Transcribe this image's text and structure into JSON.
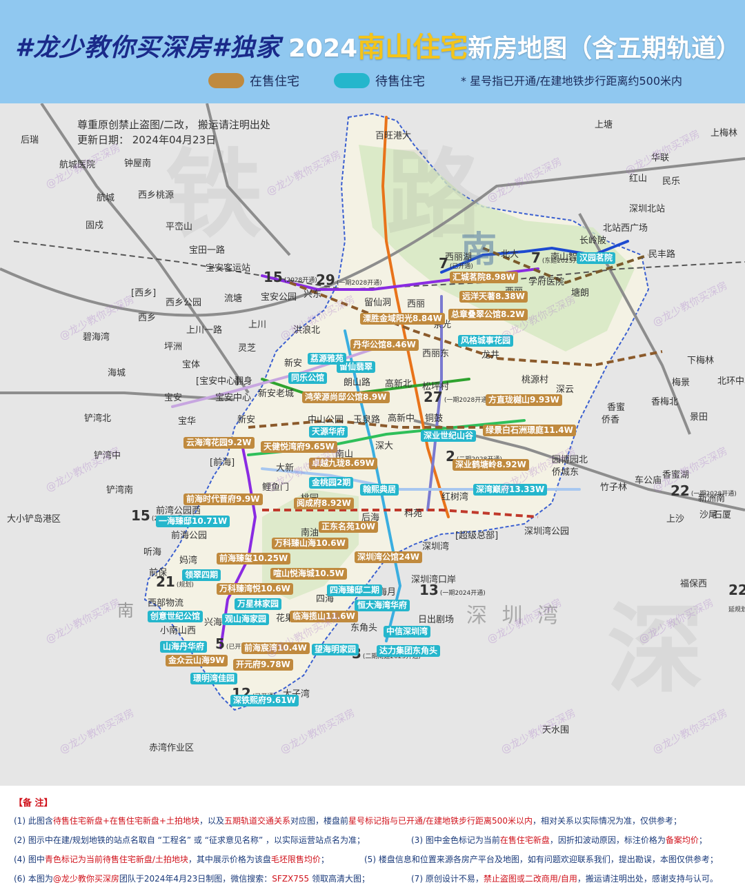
{
  "header": {
    "title_left": "#龙少教你买深房#独家",
    "title_year": "2024",
    "title_highlight": "南山住宅",
    "title_rest": "新房地图（含五期轨道）",
    "legend": {
      "on_sale": "在售住宅",
      "pending": "待售住宅",
      "star_note": "* 星号指已开通/在建地铁步行距离约500米内"
    }
  },
  "colors": {
    "on_sale": "#c08a3e",
    "pending": "#25b6cc",
    "header_bg": "#90c8f0",
    "highlight": "#f3c41b",
    "line_5": "#8a2be2",
    "line_7": "#1d4ad0",
    "line_13": "#7a7ad0",
    "line_15": "#2fa32f",
    "line_29": "#e8731a",
    "line_12": "#3aaee0",
    "line_2": "#a7c7f0"
  },
  "map": {
    "notice_1": "尊重原创禁止盗图/二改， 搬运请注明出处",
    "notice_2": "更新日期： 2024年04月23日",
    "district_watermark": "南",
    "bg_watermark_1": "铁",
    "bg_watermark_2": "路",
    "bg_watermark_3": "深",
    "watermark_text": "@龙少教你买深房",
    "places": [
      {
        "id": "houruai",
        "text": "后瑞"
      },
      {
        "id": "hangcheng-hospital",
        "text": "航城医院"
      },
      {
        "id": "zhongwuji",
        "text": "钟屋南"
      },
      {
        "id": "xixiang-taoyuan",
        "text": "西乡桃源"
      },
      {
        "id": "hangcheng",
        "text": "航城"
      },
      {
        "id": "gucheng",
        "text": "固戍"
      },
      {
        "id": "pingmanan",
        "text": "平峦山"
      },
      {
        "id": "baotian1",
        "text": "宝田一路"
      },
      {
        "id": "baoan-station",
        "text": "宝安客运站"
      },
      {
        "id": "liutang",
        "text": "流塘"
      },
      {
        "id": "baoan-park",
        "text": "宝安公园"
      },
      {
        "id": "xingdong",
        "text": "兴东"
      },
      {
        "id": "xixiang",
        "text": "[西乡]"
      },
      {
        "id": "xixiang-park",
        "text": "西乡公园"
      },
      {
        "id": "xixiang2",
        "text": "西乡"
      },
      {
        "id": "shangchuan1",
        "text": "上川一路"
      },
      {
        "id": "shangchuan",
        "text": "上川"
      },
      {
        "id": "honglangbei",
        "text": "洪浪北"
      },
      {
        "id": "bihaiwan",
        "text": "碧海湾"
      },
      {
        "id": "pingzhou",
        "text": "坪洲"
      },
      {
        "id": "lingzhi",
        "text": "灵芝"
      },
      {
        "id": "haicheng",
        "text": "海城"
      },
      {
        "id": "baoti",
        "text": "宝体"
      },
      {
        "id": "baoan-center",
        "text": "[宝安中心]"
      },
      {
        "id": "fanshen",
        "text": "翻身"
      },
      {
        "id": "baoan",
        "text": "宝安"
      },
      {
        "id": "baoan-center2",
        "text": "宝安中心"
      },
      {
        "id": "xinan-old",
        "text": "新安老城"
      },
      {
        "id": "xinan",
        "text": "新安"
      },
      {
        "id": "xinan2",
        "text": "新安"
      },
      {
        "id": "liyuwan-north",
        "text": "铲湾北"
      },
      {
        "id": "baohua",
        "text": "宝华"
      },
      {
        "id": "liyuwan-mid",
        "text": "铲湾中"
      },
      {
        "id": "liyuwan-south",
        "text": "铲湾南"
      },
      {
        "id": "qianhai",
        "text": "[前海]"
      },
      {
        "id": "daxiaochan",
        "text": "大小铲岛港区"
      },
      {
        "id": "qianwan-park-west",
        "text": "前湾公园西"
      },
      {
        "id": "qianwan-park",
        "text": "前海公园"
      },
      {
        "id": "tinghai",
        "text": "听海"
      },
      {
        "id": "mawan",
        "text": "妈湾"
      },
      {
        "id": "qianbao",
        "text": "前保"
      },
      {
        "id": "xibu-wuliu",
        "text": "西部物流"
      },
      {
        "id": "xiaonanshan-west",
        "text": "小南山西"
      },
      {
        "id": "xinghai",
        "text": "兴海"
      },
      {
        "id": "baishizhou-big",
        "text": "百旺港大"
      },
      {
        "id": "xili-lake",
        "text": "西丽湖"
      },
      {
        "id": "beida",
        "text": "北大"
      },
      {
        "id": "nanshan-zhiyuan",
        "text": "南山智园"
      },
      {
        "id": "changlingpi",
        "text": "长岭陂"
      },
      {
        "id": "xueyuan-hospital",
        "text": "学府医院"
      },
      {
        "id": "tanglang",
        "text": "塘朗"
      },
      {
        "id": "liuxiandong",
        "text": "留仙洞"
      },
      {
        "id": "xixi",
        "text": "西丽"
      },
      {
        "id": "xili-river",
        "text": "西丽"
      },
      {
        "id": "chaguang",
        "text": "茶光"
      },
      {
        "id": "longjing",
        "text": "龙井"
      },
      {
        "id": "taoyuan-village",
        "text": "桃源村"
      },
      {
        "id": "xinli-east",
        "text": "西丽东"
      },
      {
        "id": "shenyun",
        "text": "深云"
      },
      {
        "id": "gaoxin-north",
        "text": "高新北"
      },
      {
        "id": "songping",
        "text": "松坪村"
      },
      {
        "id": "mingtan",
        "text": "朗山路"
      },
      {
        "id": "gaoxin-mid",
        "text": "高新中"
      },
      {
        "id": "tongding",
        "text": "铜鼓"
      },
      {
        "id": "zhongshan-park",
        "text": "中山公园"
      },
      {
        "id": "yuquan",
        "text": "玉泉路"
      },
      {
        "id": "nanshan",
        "text": "南山"
      },
      {
        "id": "shenda",
        "text": "深大"
      },
      {
        "id": "dongxin",
        "text": "大新"
      },
      {
        "id": "liyumen",
        "text": "鲤鱼门"
      },
      {
        "id": "taoyuan",
        "text": "桃园"
      },
      {
        "id": "nanyou",
        "text": "南油"
      },
      {
        "id": "houhai",
        "text": "后海"
      },
      {
        "id": "kejinan",
        "text": "科苑"
      },
      {
        "id": "honglihu",
        "text": "红树湾"
      },
      {
        "id": "shenzhenwan-park",
        "text": "深圳湾公园"
      },
      {
        "id": "super-hq",
        "text": "[超级总部]"
      },
      {
        "id": "shenzhenwan",
        "text": "深圳湾"
      },
      {
        "id": "sz-bay-port",
        "text": "深圳湾口岸"
      },
      {
        "id": "dongjiao",
        "text": "东角头"
      },
      {
        "id": "sihai",
        "text": "四海"
      },
      {
        "id": "haiyue",
        "text": "海月"
      },
      {
        "id": "huaguo",
        "text": "花果"
      },
      {
        "id": "risheng",
        "text": "日出剧场"
      },
      {
        "id": "nanshan-dist",
        "text": "南"
      },
      {
        "id": "chiwan",
        "text": "赤湾作业区"
      },
      {
        "id": "taizi",
        "text": "大子湾"
      },
      {
        "id": "yuanhu",
        "text": "园博园北"
      },
      {
        "id": "qiaocheng-east",
        "text": "侨城东"
      },
      {
        "id": "xiangmihu",
        "text": "香蜜湖"
      },
      {
        "id": "chegongmiao",
        "text": "车公庙"
      },
      {
        "id": "zhuzilin",
        "text": "竹子林"
      },
      {
        "id": "shangsha",
        "text": "上沙"
      },
      {
        "id": "futian-bonded",
        "text": "福保西"
      },
      {
        "id": "tianshui",
        "text": "天水围"
      },
      {
        "id": "shenzhen-bay",
        "text": "深 圳 湾"
      },
      {
        "id": "shangtang",
        "text": "上塘"
      },
      {
        "id": "hualian",
        "text": "华联"
      },
      {
        "id": "hongshan",
        "text": "红山"
      },
      {
        "id": "minle",
        "text": "民乐"
      },
      {
        "id": "shenzhen-north",
        "text": "深圳北站"
      },
      {
        "id": "shenzhen-north-west",
        "text": "北站西广场"
      },
      {
        "id": "xinmin",
        "text": "民丰路"
      },
      {
        "id": "xiameilin",
        "text": "下梅林"
      },
      {
        "id": "meijing",
        "text": "梅景"
      },
      {
        "id": "xiangmei-north",
        "text": "香梅北"
      },
      {
        "id": "jingtian",
        "text": "景田"
      },
      {
        "id": "xiangmi",
        "text": "香蜜"
      },
      {
        "id": "qiaoxiang",
        "text": "侨香"
      },
      {
        "id": "bei-huan",
        "text": "北环中心"
      },
      {
        "id": "xinzhou-south",
        "text": "新洲南"
      },
      {
        "id": "shawei",
        "text": "沙尾"
      },
      {
        "id": "shi-ha",
        "text": "石厦"
      },
      {
        "id": "shenghuo",
        "text": "上梅林"
      }
    ],
    "line_numbers": [
      {
        "id": "l15-top",
        "text": "15",
        "note": "(2028开通)"
      },
      {
        "id": "l29",
        "text": "29",
        "note": "(一期2028开通)"
      },
      {
        "id": "l7-left",
        "text": "7",
        "note": "(已开通)"
      },
      {
        "id": "l7-right",
        "text": "7",
        "note": "(东延2025开通)"
      },
      {
        "id": "l27",
        "text": "27",
        "note": "(一期2028开通)"
      },
      {
        "id": "l2",
        "text": "2",
        "note": "(二期2028开通)"
      },
      {
        "id": "l15-bottom",
        "text": "15",
        "note": "(2028开通)"
      },
      {
        "id": "l21",
        "text": "21",
        "note": "(规划)"
      },
      {
        "id": "l13",
        "text": "13",
        "note": "(一期2024开通)"
      },
      {
        "id": "l5",
        "text": "5",
        "note": "(已开通)"
      },
      {
        "id": "l12",
        "text": "12",
        "note": "(已开通)"
      },
      {
        "id": "l3",
        "text": "3",
        "note": "(二期南延2025开通)"
      },
      {
        "id": "l22",
        "text": "22",
        "note": "(一期2028开通)"
      },
      {
        "id": "l22b",
        "text": "22",
        "note": "(南延规划)"
      }
    ],
    "estates": [
      {
        "id": "e1",
        "text": "汇城茗院8.98W",
        "status": "on_sale"
      },
      {
        "id": "e2",
        "text": "远洋天著8.38W",
        "status": "on_sale"
      },
      {
        "id": "e3",
        "text": "总章叠翠公馆8.2W",
        "status": "on_sale"
      },
      {
        "id": "e4",
        "text": "汉园茗院",
        "status": "pending"
      },
      {
        "id": "e5",
        "text": "溧胜金域阳光8.84W",
        "status": "on_sale"
      },
      {
        "id": "e6",
        "text": "丹华公馆8.46W",
        "status": "on_sale"
      },
      {
        "id": "e7",
        "text": "风格城事花园",
        "status": "pending"
      },
      {
        "id": "e8",
        "text": "留仙翡翠",
        "status": "pending"
      },
      {
        "id": "e9",
        "text": "荔源雅苑",
        "status": "pending"
      },
      {
        "id": "e10",
        "text": "同乐公馆",
        "status": "pending"
      },
      {
        "id": "e11",
        "text": "鸿荣源尚邸公馆8.9W",
        "status": "on_sale"
      },
      {
        "id": "e12",
        "text": "方直珑樾山9.93W",
        "status": "on_sale"
      },
      {
        "id": "e13",
        "text": "天源华府",
        "status": "pending"
      },
      {
        "id": "e14",
        "text": "深业世纪山谷",
        "status": "pending"
      },
      {
        "id": "e15",
        "text": "绿景白石洲璟庭11.4W",
        "status": "on_sale"
      },
      {
        "id": "e16",
        "text": "云海湾花园9.2W",
        "status": "on_sale"
      },
      {
        "id": "e17",
        "text": "天健悦湾府9.65W",
        "status": "on_sale"
      },
      {
        "id": "e18",
        "text": "卓越九珑8.69W",
        "status": "on_sale"
      },
      {
        "id": "e19",
        "text": "深业鹤塘岭8.92W",
        "status": "on_sale"
      },
      {
        "id": "e20",
        "text": "金桃园2期",
        "status": "pending"
      },
      {
        "id": "e21",
        "text": "翰熙典居",
        "status": "pending"
      },
      {
        "id": "e22",
        "text": "深湾巅府13.33W",
        "status": "pending"
      },
      {
        "id": "e23",
        "text": "前海时代晋府9.9W",
        "status": "on_sale"
      },
      {
        "id": "e24",
        "text": "阅成府8.92W",
        "status": "on_sale"
      },
      {
        "id": "e25",
        "text": "一海臻邸10.71W",
        "status": "pending"
      },
      {
        "id": "e26",
        "text": "正东名苑10W",
        "status": "on_sale"
      },
      {
        "id": "e27",
        "text": "万科臻山海10.6W",
        "status": "on_sale"
      },
      {
        "id": "e28",
        "text": "前海臻玺10.25W",
        "status": "on_sale"
      },
      {
        "id": "e29",
        "text": "深圳湾公馆24W",
        "status": "on_sale"
      },
      {
        "id": "e30",
        "text": "领翠四期",
        "status": "pending"
      },
      {
        "id": "e31",
        "text": "喧山悦海城10.5W",
        "status": "on_sale"
      },
      {
        "id": "e32",
        "text": "万科臻湾悦10.6W",
        "status": "on_sale"
      },
      {
        "id": "e33",
        "text": "四海臻邸二期",
        "status": "pending"
      },
      {
        "id": "e34",
        "text": "万星林家园",
        "status": "pending"
      },
      {
        "id": "e35",
        "text": "恒大海湾华府",
        "status": "pending"
      },
      {
        "id": "e36",
        "text": "创意世纪公馆",
        "status": "pending"
      },
      {
        "id": "e37",
        "text": "观山海家园",
        "status": "pending"
      },
      {
        "id": "e38",
        "text": "临海揽山11.6W",
        "status": "on_sale"
      },
      {
        "id": "e39",
        "text": "中信深圳湾",
        "status": "pending"
      },
      {
        "id": "e40",
        "text": "山海丹华府",
        "status": "pending"
      },
      {
        "id": "e41",
        "text": "前海宸湾10.4W",
        "status": "on_sale"
      },
      {
        "id": "e42",
        "text": "望海明家园",
        "status": "pending"
      },
      {
        "id": "e43",
        "text": "达力集团东角头",
        "status": "pending"
      },
      {
        "id": "e44",
        "text": "金众云山海9W",
        "status": "on_sale"
      },
      {
        "id": "e45",
        "text": "开元府9.78W",
        "status": "on_sale"
      },
      {
        "id": "e46",
        "text": "璟明湾佳园",
        "status": "pending"
      },
      {
        "id": "e47",
        "text": "深铁熙府9.61W",
        "status": "pending"
      }
    ]
  },
  "notes": {
    "heading": "【备 注】",
    "n1_a": "(1) 此图含",
    "n1_red": "待售住宅新盘+在售住宅新盘+土拍地块",
    "n1_b": "，以及",
    "n1_red2": "五期轨道交通关系",
    "n1_c": "对应图，楼盘前",
    "n1_red3": "星号标记指与已开通/在建地铁步行距离500米以内",
    "n1_d": "，相对关系以实际情况为准，仅供参考；",
    "n2": "(2) 图示中在建/规划地铁的站点名取自 “工程名” 或 “征求意见名称” ，以实际运营站点名为准；",
    "n3_a": "(3) 图中金色标记为当前",
    "n3_red": "在售住宅新盘",
    "n3_b": "，因折扣波动原因，标注价格为",
    "n3_red2": "备案均价",
    "n3_c": "；",
    "n4_a": "(4) 图中",
    "n4_red": "青色标记为当前待售住宅新盘/土拍地块",
    "n4_b": "，其中展示价格为该盘",
    "n4_red2": "毛坯限售均价",
    "n4_c": "；",
    "n5": "(5) 楼盘信息和位置来源各房产平台及地图，如有问题欢迎联系我们，提出勘误，本图仅供参考；",
    "n6_a": "(6) 本图为",
    "n6_red": "@龙少教你买深房",
    "n6_b": "团队于2024年4月23日制图，微信搜索：",
    "n6_red2": "SFZX755",
    "n6_c": " 领取高清大图；",
    "n7_a": "(7) 原创设计不易，",
    "n7_red": "禁止盗图或二改商用/自用",
    "n7_b": "，搬运请注明出处，感谢支持与认可。"
  }
}
